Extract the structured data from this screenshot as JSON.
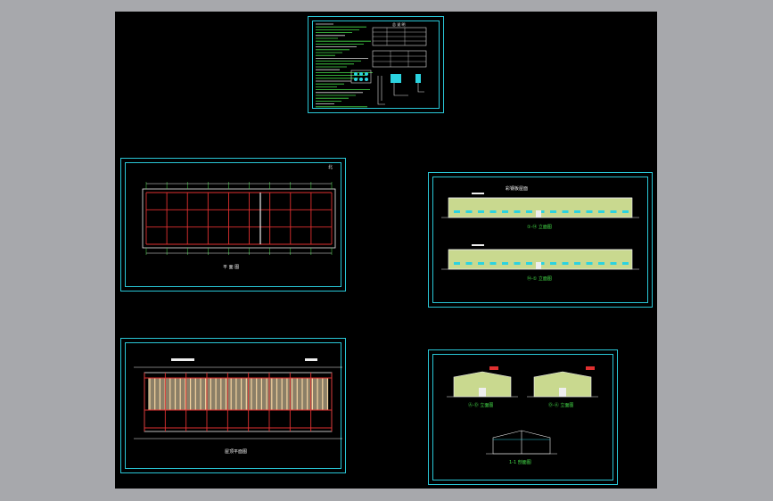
{
  "app": {
    "background_color": "#a7a8ac",
    "viewport_color": "#000000",
    "frame_color": "#29c6d6"
  },
  "sheets": {
    "notes": {
      "title": "总 说 明"
    },
    "plan": {
      "north_label": "北",
      "caption": "平 面 图"
    },
    "elevations_long": {
      "caption_top": "①-⑭ 立面图",
      "caption_bottom": "⑭-① 立面图",
      "roof_tag": "彩钢板屋面"
    },
    "roof_plan": {
      "caption": "屋顶平面图"
    },
    "elevations_end": {
      "caption_left": "Ⓐ-Ⓓ 立面图",
      "caption_right": "Ⓓ-Ⓐ 立面图",
      "caption_section": "1-1 剖面图"
    }
  }
}
